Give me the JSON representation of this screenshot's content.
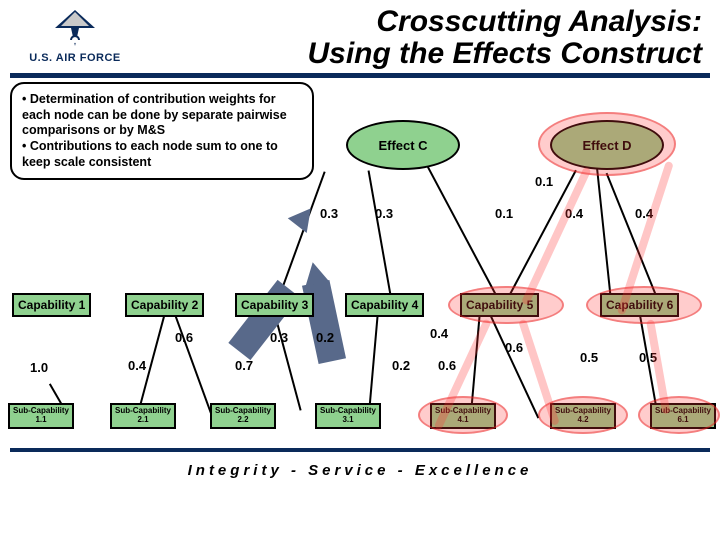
{
  "header": {
    "org": "U.S. AIR FORCE",
    "title_line1": "Crosscutting Analysis:",
    "title_line2": "Using the Effects Construct"
  },
  "callout": {
    "bullet1": "• Determination of contribution weights for each node can be done by separate pairwise comparisons or by M&S",
    "bullet2": "• Contributions to each node sum to one to keep scale consistent"
  },
  "effects": {
    "c": "Effect C",
    "d": "Effect D"
  },
  "capabilities": {
    "c1": "Capability 1",
    "c2": "Capability 2",
    "c3": "Capability 3",
    "c4": "Capability 4",
    "c5": "Capability 5",
    "c6": "Capability 6"
  },
  "subcaps": {
    "s11": "Sub-Capability\n1.1",
    "s21": "Sub-Capability\n2.1",
    "s22": "Sub-Capability\n2.2",
    "s31": "Sub-Capability\n3.1",
    "s41": "Sub-Capability\n4.1",
    "s42": "Sub-Capability\n4.2",
    "s61": "Sub-Capability\n6.1"
  },
  "weights": {
    "w01a": "0.1",
    "w01b": "0.1",
    "w03a": "0.3",
    "w03b": "0.3",
    "w04a": "0.4",
    "w04b": "0.4",
    "w06a": "0.6",
    "w04c": "0.4",
    "w10": "1.0",
    "w03c": "0.3",
    "w02a": "0.2",
    "w07": "0.7",
    "w02b": "0.2",
    "w06b": "0.6",
    "w04d": "0.4",
    "w06c": "0.6",
    "w05a": "0.5",
    "w05b": "0.5"
  },
  "motto": "Integrity - Service - Excellence"
}
